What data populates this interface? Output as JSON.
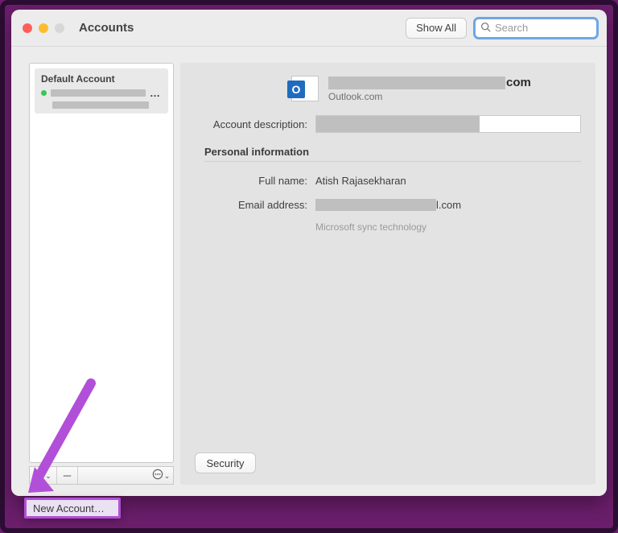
{
  "window": {
    "title": "Accounts"
  },
  "toolbar": {
    "show_all": "Show All",
    "search_placeholder": "Search"
  },
  "sidebar": {
    "accounts": [
      {
        "title": "Default Account",
        "status": "online"
      }
    ],
    "popup_item": "New Account…"
  },
  "detail": {
    "header": {
      "email_suffix": "com",
      "service": "Outlook.com"
    },
    "labels": {
      "account_description": "Account description:",
      "section_personal": "Personal information",
      "full_name": "Full name:",
      "email_address": "Email address:"
    },
    "values": {
      "full_name": "Atish Rajasekharan",
      "email_suffix": "l.com",
      "sync_note": "Microsoft sync technology"
    },
    "security_button": "Security"
  }
}
